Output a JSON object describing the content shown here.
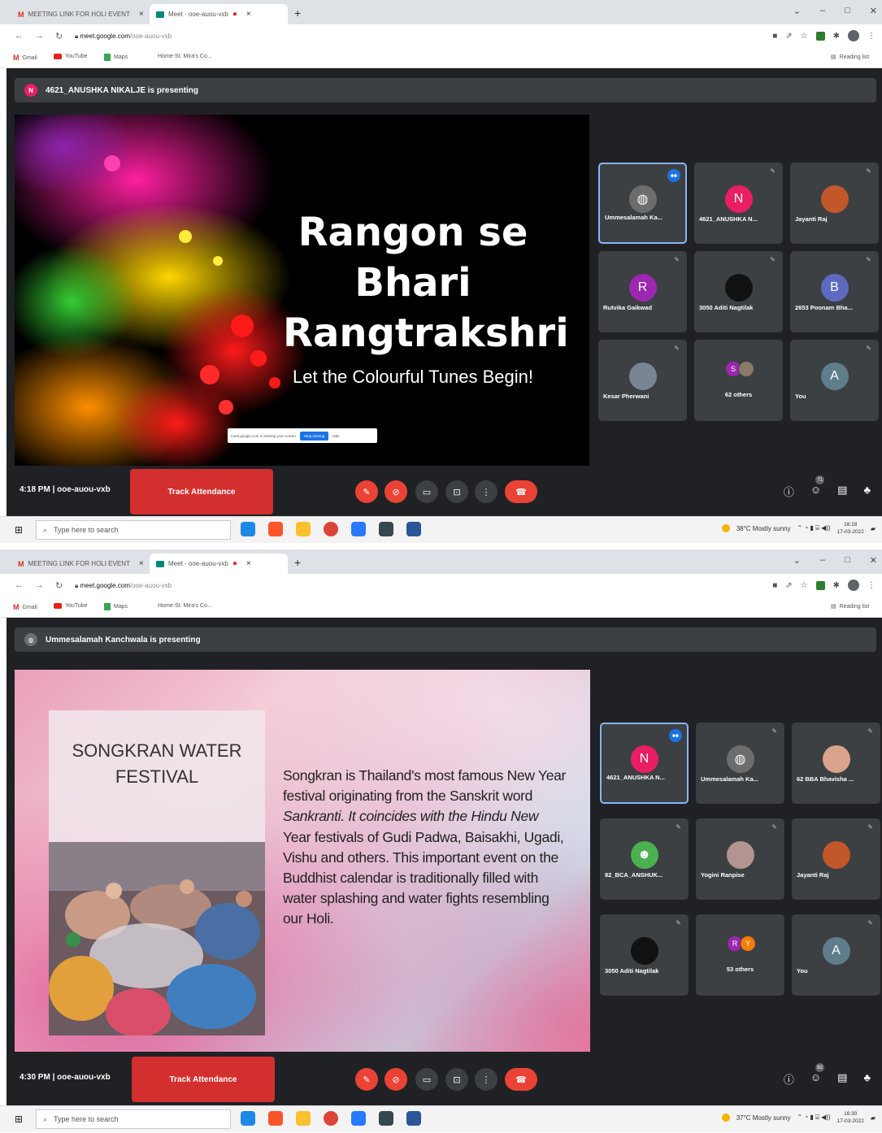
{
  "screens": [
    {
      "tabs": [
        {
          "label": "MEETING LINK FOR HOLI EVENT",
          "icon": "gmail-icon"
        },
        {
          "label": "Meet - ooe-auou-vxb",
          "icon": "meet-icon",
          "active": true
        }
      ],
      "url": {
        "host": "meet.google.com",
        "path": "/ooe-auou-vxb"
      },
      "bookmarks": [
        "Gmail",
        "YouTube",
        "Maps",
        "Home-St. Mira's Co...",
        "Reading list"
      ],
      "presenter_banner": {
        "avatar_letter": "N",
        "avatar_color": "#e91e63",
        "text": "4621_ANUSHKA NIKALJE is presenting"
      },
      "slide": {
        "title_lines": [
          "Rangon se",
          "Bhari",
          "Rangtrakshri"
        ],
        "subtitle": "Let the Colourful Tunes Begin!",
        "share_bar": {
          "text": "meet.google.com is sharing your screen.",
          "stop": "Stop sharing",
          "hide": "Hide"
        }
      },
      "tiles": [
        {
          "name": "Ummesalamah Ka...",
          "avatar": "photo",
          "color": "#6d6d6d",
          "speaking": true
        },
        {
          "name": "4621_ANUSHKA N...",
          "avatar": "N",
          "color": "#e91e63"
        },
        {
          "name": "Jayanti Raj",
          "avatar": "photo",
          "color": "#c2572a"
        },
        {
          "name": "Rutvika Gaikwad",
          "avatar": "R",
          "color": "#9c27b0"
        },
        {
          "name": "3050 Aditi Nagtilak",
          "avatar": "photo",
          "color": "#111111"
        },
        {
          "name": "2653 Poonam Bha...",
          "avatar": "B",
          "color": "#5c6bc0"
        },
        {
          "name": "Kesar Pherwani",
          "avatar": "photo",
          "color": "#7a8593"
        },
        {
          "name": "62 others",
          "avatar": "others",
          "others": [
            {
              "letter": "S",
              "color": "#9c27b0"
            },
            {
              "letter": "",
              "color": "#8a7a68"
            }
          ]
        },
        {
          "name": "You",
          "avatar": "A",
          "color": "#607d8b"
        }
      ],
      "controls": {
        "time": "4:18 PM",
        "meeting_code": "ooe-auou-vxb",
        "track_attendance": "Track Attendance",
        "participants_count": "71"
      },
      "taskbar": {
        "search_placeholder": "Type here to search",
        "weather": "38°C  Mostly sunny",
        "time": "16:18",
        "date": "17-03-2022"
      }
    },
    {
      "tabs": [
        {
          "label": "MEETING LINK FOR HOLI EVENT",
          "icon": "gmail-icon"
        },
        {
          "label": "Meet - ooe-auou-vxb",
          "icon": "meet-icon",
          "active": true
        }
      ],
      "url": {
        "host": "meet.google.com",
        "path": "/ooe-auou-vxb"
      },
      "bookmarks": [
        "Gmail",
        "YouTube",
        "Maps",
        "Home-St. Mira's Co...",
        "Reading list"
      ],
      "presenter_banner": {
        "avatar_letter": "",
        "avatar_color": "#6d6d6d",
        "text": "Ummesalamah Kanchwala is presenting"
      },
      "slide": {
        "heading_lines": [
          "SONGKRAN WATER",
          "FESTIVAL"
        ],
        "body": [
          "Songkran is Thailand's most famous New Year",
          "festival originating from the Sanskrit word",
          "Sankranti. It coincides with the Hindu New",
          "Year festivals of Gudi Padwa, Baisakhi, Ugadi,",
          "Vishu and others. This important event on the",
          "Buddhist calendar is traditionally filled with",
          "water splashing and water fights resembling",
          "our Holi."
        ]
      },
      "tiles": [
        {
          "name": "4621_ANUSHKA N...",
          "avatar": "N",
          "color": "#e91e63",
          "speaking": true
        },
        {
          "name": "Ummesalamah Ka...",
          "avatar": "photo",
          "color": "#6d6d6d"
        },
        {
          "name": "62 BBA Bhavisha ...",
          "avatar": "photo",
          "color": "#d9a38c"
        },
        {
          "name": "82_BCA_ANSHUK...",
          "avatar": "person",
          "color": "#4caf50"
        },
        {
          "name": "Yogini Ranpise",
          "avatar": "photo",
          "color": "#b39490"
        },
        {
          "name": "Jayanti Raj",
          "avatar": "photo",
          "color": "#c2572a"
        },
        {
          "name": "3050 Aditi Nagtilak",
          "avatar": "photo",
          "color": "#111111"
        },
        {
          "name": "53 others",
          "avatar": "others",
          "others": [
            {
              "letter": "R",
              "color": "#9c27b0"
            },
            {
              "letter": "Y",
              "color": "#f57c00"
            }
          ]
        },
        {
          "name": "You",
          "avatar": "A",
          "color": "#607d8b"
        }
      ],
      "controls": {
        "time": "4:30 PM",
        "meeting_code": "ooe-auou-vxb",
        "track_attendance": "Track Attendance",
        "participants_count": "62"
      },
      "taskbar": {
        "search_placeholder": "Type here to search",
        "weather": "37°C  Mostly sunny",
        "time": "16:30",
        "date": "17-03-2022"
      }
    }
  ]
}
